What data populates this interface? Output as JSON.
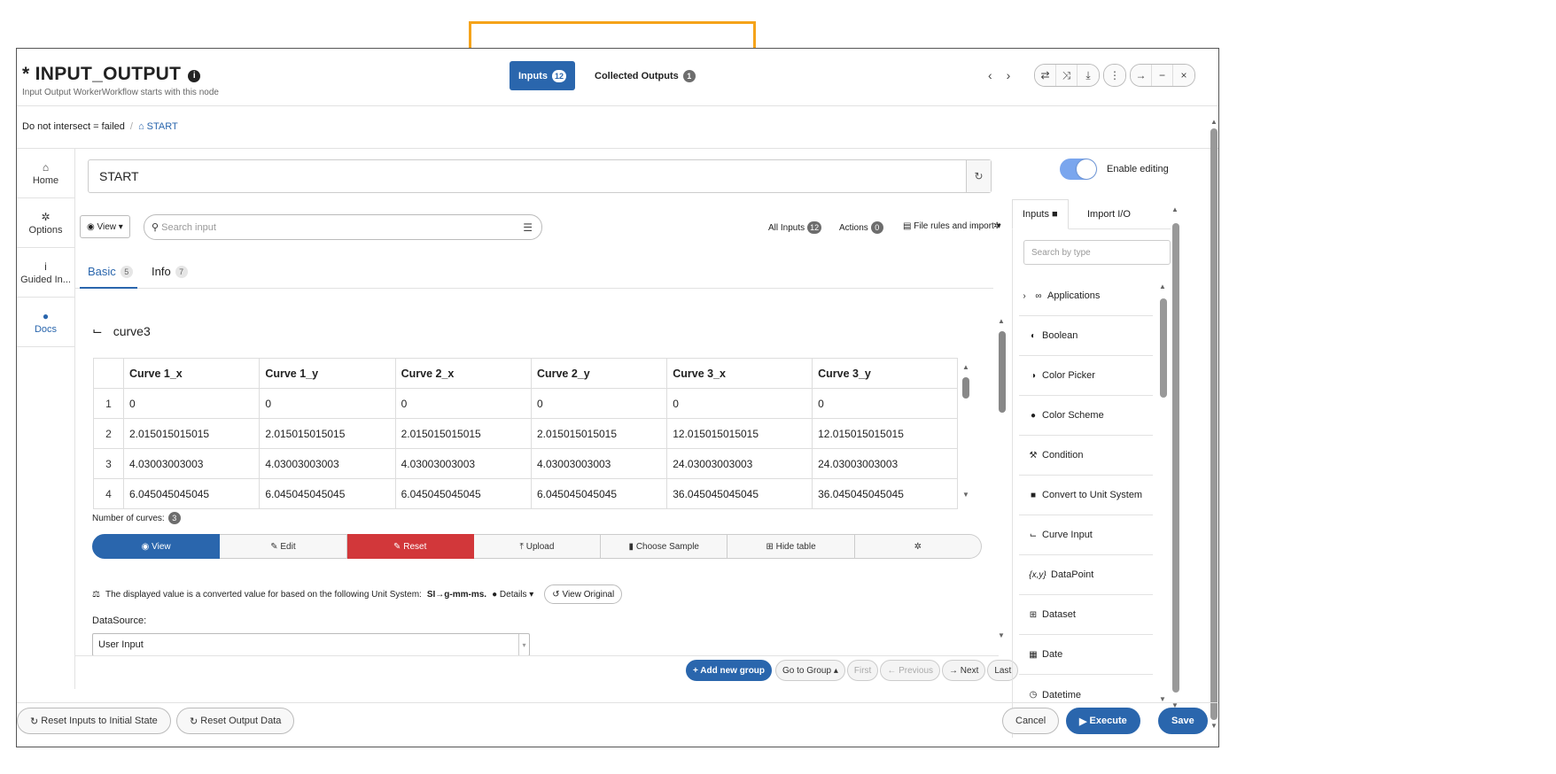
{
  "header": {
    "title_prefix": "* ",
    "title": "INPUT_OUTPUT",
    "subtitle": "Input Output WorkerWorkflow starts with this node",
    "tabs": [
      {
        "label": "Inputs",
        "count": "12"
      },
      {
        "label": "Collected Outputs",
        "count": "1"
      }
    ]
  },
  "breadcrumb": {
    "condition": "Do not intersect = failed",
    "home": "START"
  },
  "leftnav": [
    {
      "label": "Home",
      "icon": "home-icon"
    },
    {
      "label": "Options",
      "icon": "gear-icon"
    },
    {
      "label": "Guided In...",
      "icon": "info-icon"
    },
    {
      "label": "Docs",
      "icon": "info-circle-icon"
    }
  ],
  "node_name": "START",
  "toolbar": {
    "view": "View",
    "search_placeholder": "Search input",
    "all_inputs": "All Inputs",
    "all_inputs_count": "12",
    "actions": "Actions",
    "actions_count": "0",
    "file_rules": "File rules and import"
  },
  "subtabs": [
    {
      "label": "Basic",
      "count": "5"
    },
    {
      "label": "Info",
      "count": "7"
    }
  ],
  "curve": {
    "name": "curve3",
    "columns": [
      "Curve 1_x",
      "Curve 1_y",
      "Curve 2_x",
      "Curve 2_y",
      "Curve 3_x",
      "Curve 3_y"
    ],
    "rows": [
      {
        "n": "1",
        "cells": [
          "0",
          "0",
          "0",
          "0",
          "0",
          "0"
        ]
      },
      {
        "n": "2",
        "cells": [
          "2.015015015015",
          "2.015015015015",
          "2.015015015015",
          "2.015015015015",
          "12.015015015015",
          "12.015015015015"
        ]
      },
      {
        "n": "3",
        "cells": [
          "4.03003003003",
          "4.03003003003",
          "4.03003003003",
          "4.03003003003",
          "24.03003003003",
          "24.03003003003"
        ]
      },
      {
        "n": "4",
        "cells": [
          "6.045045045045",
          "6.045045045045",
          "6.045045045045",
          "6.045045045045",
          "36.045045045045",
          "36.045045045045"
        ]
      }
    ],
    "num_curves_label": "Number of curves:",
    "num_curves": "3"
  },
  "actionbar": [
    "View",
    "Edit",
    "Reset",
    "Upload",
    "Choose Sample",
    "Hide table"
  ],
  "unit": {
    "text": "The displayed value is a converted value for based on the following Unit System:",
    "system": "SI→g-mm-ms.",
    "details": "Details",
    "view_original": "View Original"
  },
  "datasource": {
    "label": "DataSource:",
    "value": "User Input"
  },
  "pager": {
    "add_group": "+ Add new group",
    "go_to_group": "Go to Group",
    "first": "First",
    "previous": "Previous",
    "next": "Next",
    "last": "Last"
  },
  "right": {
    "enable_editing": "Enable editing",
    "tabs": [
      "Inputs",
      "Import I/O"
    ],
    "search_placeholder": "Search by type",
    "items": [
      {
        "label": "Applications",
        "icon": "link-icon"
      },
      {
        "label": "Boolean",
        "icon": "toggle-icon"
      },
      {
        "label": "Color Picker",
        "icon": "half-circle-icon"
      },
      {
        "label": "Color Scheme",
        "icon": "palette-icon"
      },
      {
        "label": "Condition",
        "icon": "gavel-icon"
      },
      {
        "label": "Convert to Unit System",
        "icon": "unit-icon"
      },
      {
        "label": "Curve Input",
        "icon": "line-chart-icon"
      },
      {
        "label": "DataPoint",
        "icon": "xy-icon"
      },
      {
        "label": "Dataset",
        "icon": "grid-icon"
      },
      {
        "label": "Date",
        "icon": "calendar-icon"
      },
      {
        "label": "Datetime",
        "icon": "clock-icon"
      }
    ]
  },
  "footer": {
    "reset_inputs": "Reset Inputs to Initial State",
    "reset_output": "Reset Output Data",
    "cancel": "Cancel",
    "execute": "Execute",
    "save": "Save"
  },
  "colors": {
    "accent": "#2a66ad",
    "danger": "#d2373a",
    "highlight": "#f5a31a",
    "toggle": "#7aa6ee"
  }
}
